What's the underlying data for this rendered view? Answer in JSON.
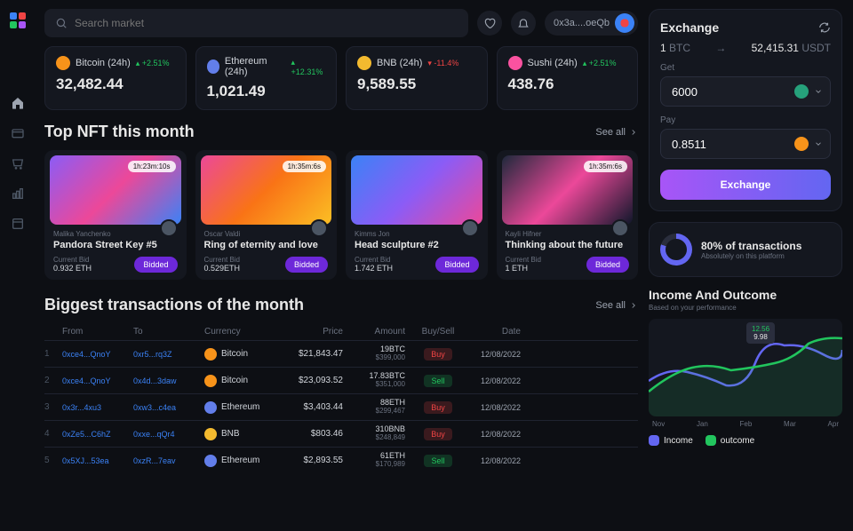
{
  "search": {
    "placeholder": "Search market"
  },
  "wallet": {
    "address": "0x3a....oeQb"
  },
  "tickers": [
    {
      "name": "Bitcoin (24h)",
      "coin": "btc",
      "change": "+2.51%",
      "dir": "up",
      "price": "32,482.44"
    },
    {
      "name": "Ethereum (24h)",
      "coin": "eth",
      "change": "+12.31%",
      "dir": "up",
      "price": "1,021.49"
    },
    {
      "name": "BNB (24h)",
      "coin": "bnb",
      "change": "-11.4%",
      "dir": "down",
      "price": "9,589.55"
    },
    {
      "name": "Sushi (24h)",
      "coin": "sushi",
      "change": "+2.51%",
      "dir": "up",
      "price": "438.76"
    }
  ],
  "nft": {
    "title": "Top NFT this month",
    "see_all": "See all",
    "cards": [
      {
        "time": "1h:23m:10s",
        "author": "Malika Yanchenko",
        "title": "Pandora Street Key #5",
        "bid_label": "Current Bid",
        "bid": "0.932 ETH",
        "btn": "Bidded"
      },
      {
        "time": "1h:35m:6s",
        "author": "Oscar Valdi",
        "title": "Ring of eternity and love",
        "bid_label": "Current Bid",
        "bid": "0.529ETH",
        "btn": "Bidded"
      },
      {
        "time": "",
        "author": "Kimms Jon",
        "title": "Head sculpture #2",
        "bid_label": "Current Bid",
        "bid": "1.742 ETH",
        "btn": "Bidded"
      },
      {
        "time": "1h:35m:6s",
        "author": "Kayli Hifner",
        "title": "Thinking about the future",
        "bid_label": "Current Bid",
        "bid": "1 ETH",
        "btn": "Bidded"
      }
    ]
  },
  "tx": {
    "title": "Biggest transactions of the month",
    "see_all": "See all",
    "head": {
      "from": "From",
      "to": "To",
      "currency": "Currency",
      "price": "Price",
      "amount": "Amount",
      "bs": "Buy/Sell",
      "date": "Date"
    },
    "rows": [
      {
        "i": "1",
        "from": "0xce4...QnoY",
        "to": "0xr5...rq3Z",
        "cur": "Bitcoin",
        "coin": "btc",
        "price": "$21,843.47",
        "a1": "19BTC",
        "a2": "$399,000",
        "bs": "Buy",
        "date": "12/08/2022"
      },
      {
        "i": "2",
        "from": "0xce4...QnoY",
        "to": "0x4d...3daw",
        "cur": "Bitcoin",
        "coin": "btc",
        "price": "$23,093.52",
        "a1": "17.83BTC",
        "a2": "$351,000",
        "bs": "Sell",
        "date": "12/08/2022"
      },
      {
        "i": "3",
        "from": "0x3r...4xu3",
        "to": "0xw3...c4ea",
        "cur": "Ethereum",
        "coin": "eth",
        "price": "$3,403.44",
        "a1": "88ETH",
        "a2": "$299,467",
        "bs": "Buy",
        "date": "12/08/2022"
      },
      {
        "i": "4",
        "from": "0xZe5...C6hZ",
        "to": "0xxe...qQr4",
        "cur": "BNB",
        "coin": "bnb",
        "price": "$803.46",
        "a1": "310BNB",
        "a2": "$248,849",
        "bs": "Buy",
        "date": "12/08/2022"
      },
      {
        "i": "5",
        "from": "0x5XJ...53ea",
        "to": "0xzR...7eav",
        "cur": "Ethereum",
        "coin": "eth",
        "price": "$2,893.55",
        "a1": "61ETH",
        "a2": "$170,989",
        "bs": "Sell",
        "date": "12/08/2022"
      }
    ]
  },
  "exchange": {
    "title": "Exchange",
    "from_amt": "1",
    "from_cur": "BTC",
    "arrow": "→",
    "to_amt": "52,415.31",
    "to_cur": "USDT",
    "get_label": "Get",
    "get_val": "6000",
    "pay_label": "Pay",
    "pay_val": "0.8511",
    "btn": "Exchange"
  },
  "stat": {
    "pct": "80% of transactions",
    "sub": "Absolutely on this platform"
  },
  "io": {
    "title": "Income And Outcome",
    "sub": "Based on your performance",
    "tooltip": {
      "v1": "12.56",
      "v2": "9.98"
    },
    "months": [
      "Nov",
      "Jan",
      "Feb",
      "Mar",
      "Apr"
    ],
    "legend": {
      "income": "Income",
      "outcome": "outcome"
    }
  },
  "chart_data": {
    "type": "line",
    "categories": [
      "Nov",
      "Jan",
      "Feb",
      "Mar",
      "Apr"
    ],
    "series": [
      {
        "name": "Income",
        "color": "#6366f1",
        "values": [
          7.5,
          8.2,
          7.0,
          12.5,
          11.8
        ]
      },
      {
        "name": "outcome",
        "color": "#22c55e",
        "values": [
          6.0,
          9.5,
          9.2,
          10.0,
          13.2
        ]
      }
    ],
    "ylim": [
      0,
      14
    ],
    "tooltip_point": {
      "x": "Mar",
      "income": 12.56,
      "outcome": 9.98
    }
  }
}
